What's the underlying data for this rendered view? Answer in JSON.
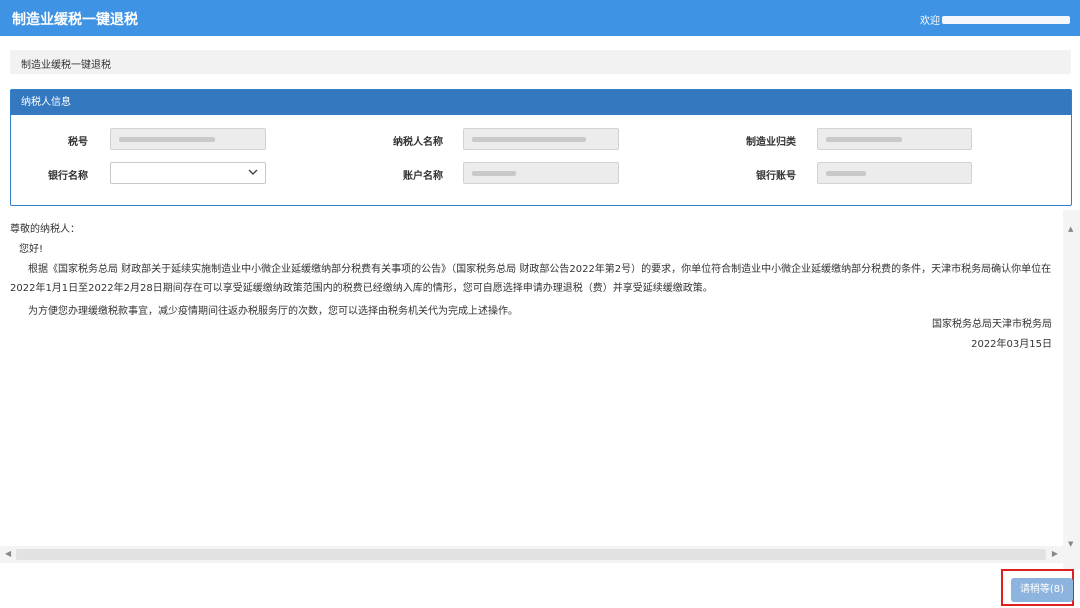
{
  "header": {
    "title": "制造业缓税一键退税",
    "welcome_prefix": "欢迎"
  },
  "breadcrumb": {
    "text": "制造业缓税一键退税"
  },
  "taxpayer_panel": {
    "heading": "纳税人信息",
    "fields": {
      "tax_id_label": "税号",
      "taxpayer_name_label": "纳税人名称",
      "manufacturing_category_label": "制造业归类",
      "bank_name_label": "银行名称",
      "account_name_label": "账户名称",
      "bank_account_label": "银行账号"
    }
  },
  "notice": {
    "salutation": "尊敬的纳税人：",
    "greeting": "您好!",
    "paragraph1": "根据《国家税务总局 财政部关于延续实施制造业中小微企业延缓缴纳部分税费有关事项的公告》（国家税务总局 财政部公告2022年第2号）的要求，你单位符合制造业中小微企业延缓缴纳部分税费的条件，天津市税务局确认你单位在2022年1月1日至2022年2月28日期间存在可以享受延缓缴纳政策范围内的税费已经缴纳入库的情形，您可自愿选择申请办理退税（费）并享受延续缓缴政策。",
    "paragraph2": "为方便您办理缓缴税款事宜，减少疫情期间往返办税服务厅的次数，您可以选择由税务机关代为完成上述操作。",
    "issuer": "国家税务总局天津市税务局",
    "date": "2022年03月15日"
  },
  "footer": {
    "wait_button_label": "请稍等(8)"
  },
  "colors": {
    "header_blue": "#3f93e4",
    "panel_blue": "#3479c0",
    "button_blue": "#8db4df",
    "highlight_red": "#e02020"
  }
}
